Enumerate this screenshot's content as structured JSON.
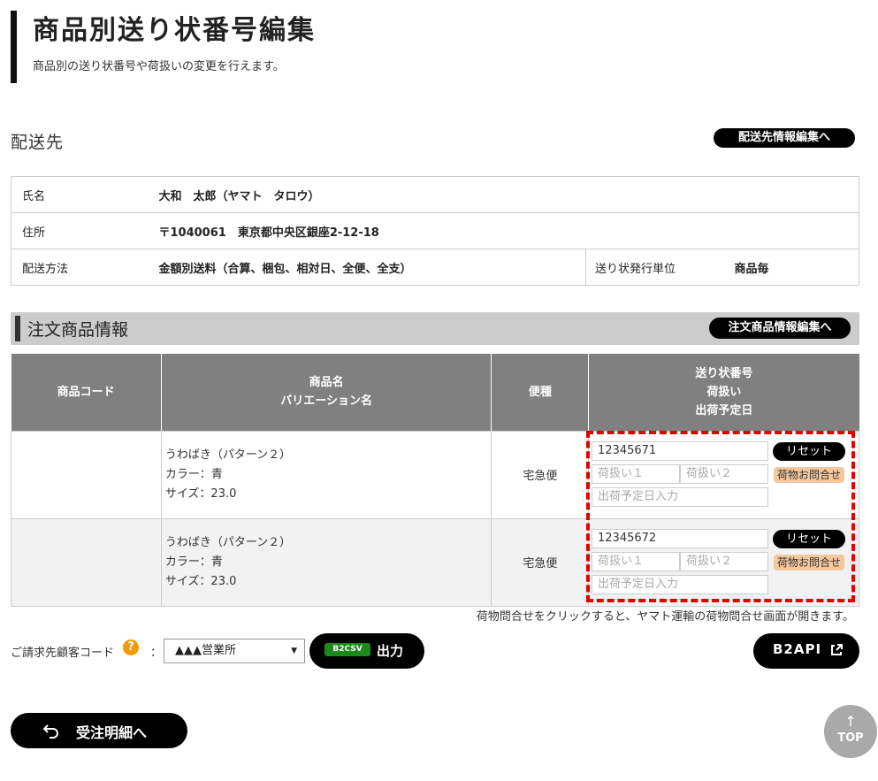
{
  "header": {
    "title": "商品別送り状番号編集",
    "subtitle": "商品別の送り状番号や荷扱いの変更を行えます。"
  },
  "shipping": {
    "heading": "配送先",
    "edit_button": "配送先情報編集へ",
    "name_label": "氏名",
    "name_value": "大和　太郎（ヤマト　タロウ）",
    "address_label": "住所",
    "address_value": "〒1040061　東京都中央区銀座2-12-18",
    "method_label": "配送方法",
    "method_value": "金額別送料（合算、梱包、相対日、全便、全支）",
    "issue_unit_label": "送り状発行単位",
    "issue_unit_value": "商品毎"
  },
  "order": {
    "heading": "注文商品情報",
    "edit_button": "注文商品情報編集へ",
    "columns": {
      "code": "商品コード",
      "name_line1": "商品名",
      "name_line2": "バリエーション名",
      "mode": "便種",
      "ship_line1": "送り状番号",
      "ship_line2": "荷扱い",
      "ship_line3": "出荷予定日"
    },
    "rows": [
      {
        "code": "",
        "name": "うわばき（パターン２）",
        "color": "カラー：青",
        "size": "サイズ：23.0",
        "mode": "宅急便",
        "tracking_number": "12345671",
        "handling1_placeholder": "荷扱い１",
        "handling2_placeholder": "荷扱い２",
        "date_placeholder": "出荷予定日入力",
        "reset_label": "リセット",
        "inquiry_label": "荷物お問合せ"
      },
      {
        "code": "",
        "name": "うわばき（パターン２）",
        "color": "カラー：青",
        "size": "サイズ：23.0",
        "mode": "宅急便",
        "tracking_number": "12345672",
        "handling1_placeholder": "荷扱い１",
        "handling2_placeholder": "荷扱い２",
        "date_placeholder": "出荷予定日入力",
        "reset_label": "リセット",
        "inquiry_label": "荷物お問合せ"
      }
    ],
    "note": "荷物問合せをクリックすると、ヤマト運輸の荷物問合せ画面が開きます。"
  },
  "billing": {
    "label": "ご請求先顧客コード",
    "help_icon": "?",
    "colon": "：",
    "selected": "▲▲▲営業所"
  },
  "actions": {
    "b2csv_badge": "B2CSV",
    "b2csv_label": "出力",
    "b2api_label": "B2API",
    "back_label": "受注明細へ",
    "top_arrow": "↑",
    "top_label": "TOP"
  },
  "colors": {
    "highlight_border": "#e00000",
    "inquiry_bg": "#f4c79d",
    "help_icon": "#f39800",
    "b2csv_badge": "#1a8a1a"
  }
}
